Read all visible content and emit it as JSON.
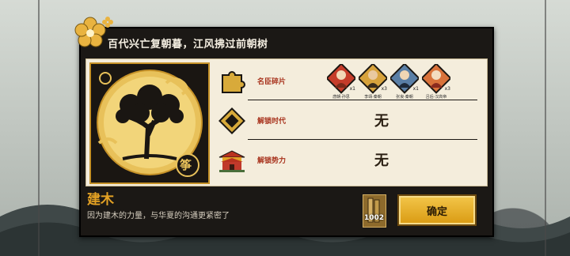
{
  "dialog": {
    "title": "百代兴亡复朝暮，江风拂过前朝树",
    "emblem_char": "筝"
  },
  "rows": [
    {
      "label": "名臣碎片",
      "icon": "puzzle-piece-icon"
    },
    {
      "label": "解锁时代",
      "icon": "diamond-emblem-icon",
      "value": "无"
    },
    {
      "label": "解锁势力",
      "icon": "palace-icon",
      "value": "无"
    }
  ],
  "heroes": [
    {
      "name": "唐朝·孙思",
      "count": "x1"
    },
    {
      "name": "李靖·秦朝",
      "count": "x3"
    },
    {
      "name": "张良·秦朝",
      "count": "x1"
    },
    {
      "name": "吕后·汉高帝",
      "count": "x3"
    }
  ],
  "footer": {
    "name": "建木",
    "description": "因为建木的力量，与华夏的沟通更紧密了",
    "item_quantity": "1002",
    "confirm_label": "确定"
  },
  "colors": {
    "accent_gold": "#e3a124",
    "label_red": "#a8331d",
    "panel_dark": "#1b1815",
    "panel_light": "#f4eddc"
  }
}
